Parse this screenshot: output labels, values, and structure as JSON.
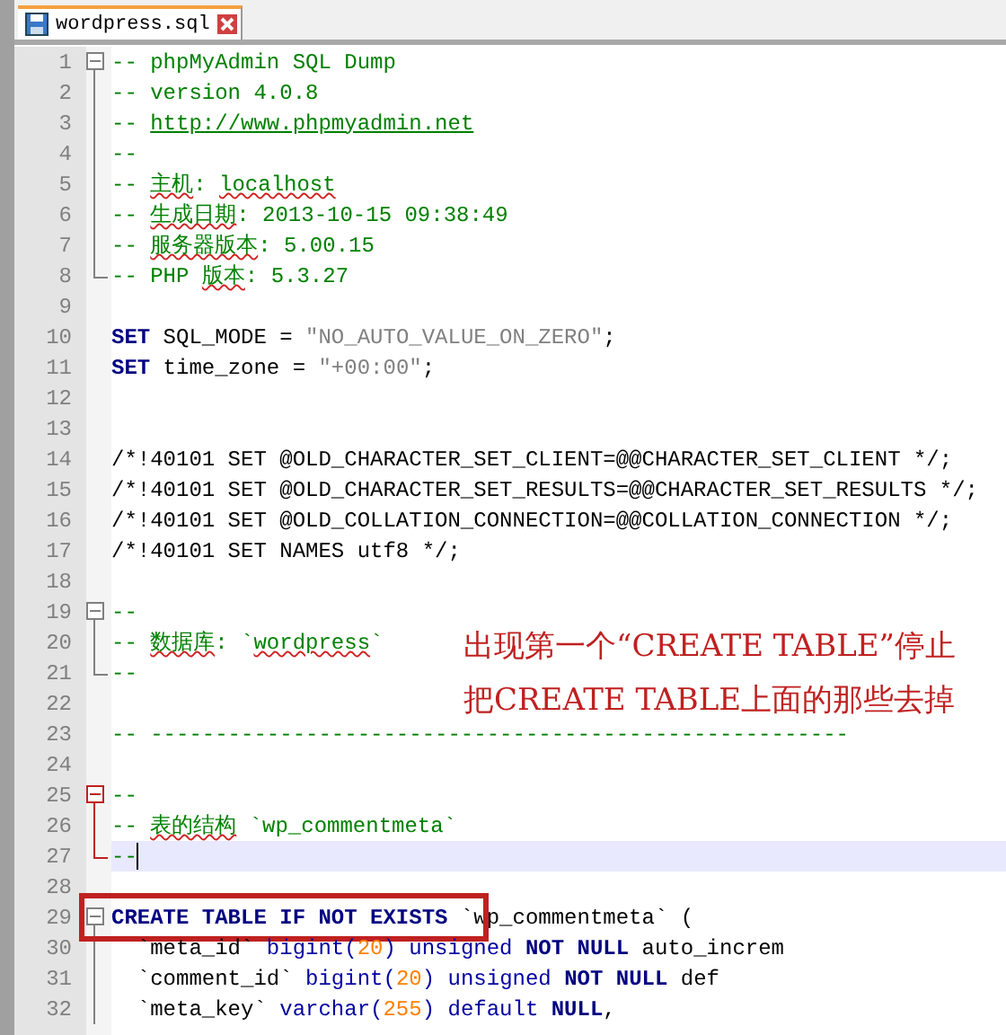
{
  "tab": {
    "title": "wordpress.sql",
    "selected": true
  },
  "lines": [
    {
      "number": "1",
      "tokens": [
        {
          "text": "-- phpMyAdmin SQL Dump",
          "kind": "comment"
        }
      ],
      "children": [
        {
          "number": "2",
          "tokens": [
            {
              "text": "-- version 4.0.8",
              "kind": "comment"
            }
          ]
        },
        {
          "number": "3",
          "tokens": [
            {
              "text": "-- ",
              "kind": "comment"
            },
            {
              "text": "http://www.phpmyadmin.net",
              "kind": "url"
            }
          ]
        },
        {
          "number": "4",
          "tokens": [
            {
              "text": "--",
              "kind": "comment"
            }
          ]
        },
        {
          "number": "5",
          "tokens": [
            {
              "text": "-- ",
              "kind": "comment"
            },
            {
              "text": "主机",
              "kind": "misspelt"
            },
            {
              "text": ": ",
              "kind": "comment"
            },
            {
              "text": "localhost",
              "kind": "misspelt"
            }
          ]
        },
        {
          "number": "6",
          "tokens": [
            {
              "text": "-- ",
              "kind": "comment"
            },
            {
              "text": "生成日期",
              "kind": "misspelt"
            },
            {
              "text": ": 2013-10-15 09:38:49",
              "kind": "comment"
            }
          ]
        },
        {
          "number": "7",
          "tokens": [
            {
              "text": "-- ",
              "kind": "comment"
            },
            {
              "text": "服务器版本",
              "kind": "misspelt"
            },
            {
              "text": ": 5.00.15",
              "kind": "comment"
            }
          ]
        },
        {
          "number": "8",
          "tokens": [
            {
              "text": "-- PHP ",
              "kind": "comment"
            },
            {
              "text": "版本",
              "kind": "misspelt"
            },
            {
              "text": ": 5.3.27",
              "kind": "comment"
            }
          ]
        }
      ]
    },
    {
      "number": "9"
    },
    {
      "number": "10",
      "tokens": [
        {
          "text": "SET",
          "kind": "keyword"
        },
        {
          "text": " SQL_MODE = ",
          "kind": "plain"
        },
        {
          "text": "\"NO_AUTO_VALUE_ON_ZERO\"",
          "kind": "string"
        },
        {
          "text": ";",
          "kind": "plain"
        }
      ]
    },
    {
      "number": "11",
      "tokens": [
        {
          "text": "SET",
          "kind": "keyword"
        },
        {
          "text": " time_zone = ",
          "kind": "plain"
        },
        {
          "text": "\"+00:00\"",
          "kind": "string"
        },
        {
          "text": ";",
          "kind": "plain"
        }
      ]
    },
    {
      "number": "12"
    },
    {
      "number": "13"
    },
    {
      "number": "14",
      "tokens": [
        {
          "text": "/*!40101 SET @OLD_CHARACTER_SET_CLIENT=@@CHARACTER_SET_CLIENT */;",
          "kind": "plain"
        }
      ]
    },
    {
      "number": "15",
      "tokens": [
        {
          "text": "/*!40101 SET @OLD_CHARACTER_SET_RESULTS=@@CHARACTER_SET_RESULTS */;",
          "kind": "plain"
        }
      ]
    },
    {
      "number": "16",
      "tokens": [
        {
          "text": "/*!40101 SET @OLD_COLLATION_CONNECTION=@@COLLATION_CONNECTION */;",
          "kind": "plain"
        }
      ]
    },
    {
      "number": "17",
      "tokens": [
        {
          "text": "/*!40101 SET NAMES utf8 */;",
          "kind": "plain"
        }
      ]
    },
    {
      "number": "18"
    },
    {
      "number": "19",
      "tokens": [
        {
          "text": "--",
          "kind": "comment"
        }
      ],
      "children": [
        {
          "number": "20",
          "tokens": [
            {
              "text": "-- ",
              "kind": "comment"
            },
            {
              "text": "数据库",
              "kind": "misspelt"
            },
            {
              "text": ": `",
              "kind": "comment"
            },
            {
              "text": "wordpress",
              "kind": "misspelt"
            },
            {
              "text": "`",
              "kind": "comment"
            }
          ]
        },
        {
          "number": "21",
          "tokens": [
            {
              "text": "--",
              "kind": "comment"
            }
          ]
        }
      ]
    },
    {
      "number": "22"
    },
    {
      "number": "23",
      "tokens": [
        {
          "text": "-- ------------------------------------------------------",
          "kind": "comment"
        }
      ]
    },
    {
      "number": "24"
    },
    {
      "number": "25",
      "active": true,
      "tokens": [
        {
          "text": "--",
          "kind": "comment"
        }
      ],
      "children": [
        {
          "number": "26",
          "tokens": [
            {
              "text": "-- ",
              "kind": "comment"
            },
            {
              "text": "表的结构",
              "kind": "misspelt"
            },
            {
              "text": " `wp_commentmeta`",
              "kind": "comment"
            }
          ]
        },
        {
          "number": "27",
          "current": true,
          "tokens": [
            {
              "text": "--",
              "kind": "comment"
            }
          ]
        }
      ]
    },
    {
      "number": "28"
    },
    {
      "number": "29",
      "boxed": true,
      "tokens": [
        {
          "text": "CREATE TABLE IF NOT EXISTS",
          "kind": "keyword"
        },
        {
          "text": " `wp_commentmeta` (",
          "kind": "plain"
        }
      ],
      "children": [
        {
          "number": "30",
          "tokens": [
            {
              "text": "  `meta_id` ",
              "kind": "plain"
            },
            {
              "text": "bigint(",
              "kind": "type"
            },
            {
              "text": "20",
              "kind": "number"
            },
            {
              "text": ") unsigned ",
              "kind": "type"
            },
            {
              "text": "NOT NULL",
              "kind": "keyword"
            },
            {
              "text": " auto_increm",
              "kind": "plain"
            }
          ]
        },
        {
          "number": "31",
          "tokens": [
            {
              "text": "  `comment_id` ",
              "kind": "plain"
            },
            {
              "text": "bigint(",
              "kind": "type"
            },
            {
              "text": "20",
              "kind": "number"
            },
            {
              "text": ") unsigned ",
              "kind": "type"
            },
            {
              "text": "NOT NULL",
              "kind": "keyword"
            },
            {
              "text": " def",
              "kind": "plain"
            }
          ]
        },
        {
          "number": "32",
          "tokens": [
            {
              "text": "  `meta_key` ",
              "kind": "plain"
            },
            {
              "text": "varchar(",
              "kind": "type"
            },
            {
              "text": "255",
              "kind": "number"
            },
            {
              "text": ") default ",
              "kind": "type"
            },
            {
              "text": "NULL",
              "kind": "keyword"
            },
            {
              "text": ",",
              "kind": "plain"
            }
          ]
        }
      ]
    }
  ],
  "annotation": {
    "lines": [
      "出现第一个“CREATE TABLE”停止",
      "把CREATE TABLE上面的那些去掉"
    ]
  }
}
